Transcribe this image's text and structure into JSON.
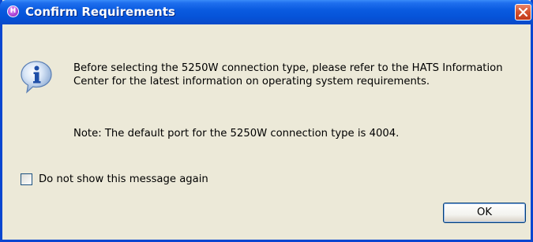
{
  "window": {
    "title": "Confirm Requirements",
    "app_icon_glyph": "H",
    "close_icon": "close-icon"
  },
  "dialog": {
    "icon": "info-icon",
    "message": "Before selecting the 5250W connection type, please refer to the HATS Information Center for the latest information on operating system requirements.",
    "note": "Note: The default port for the 5250W connection type is 4004."
  },
  "options": {
    "dont_show_label": "Do not show this message again",
    "dont_show_checked": false
  },
  "buttons": {
    "ok_label": "OK"
  },
  "colors": {
    "titlebar": "#0653d8",
    "frame": "#0a46d0",
    "dialog_bg": "#ece9d8",
    "close_button": "#d4502c"
  }
}
